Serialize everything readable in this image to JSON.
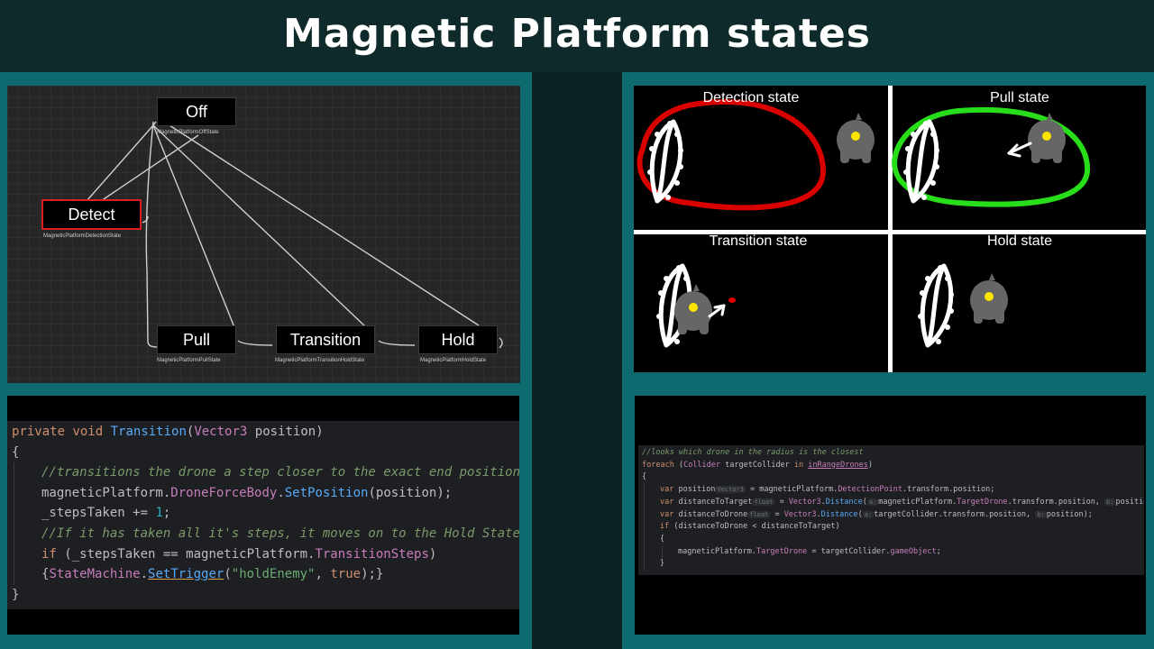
{
  "title": "Magnetic Platform states",
  "colors": {
    "background": "#0d2224",
    "accent": "#0d6a6e",
    "detect_outline": "#d90000",
    "pull_outline": "#28dd19",
    "drone": "#666666"
  },
  "state_graph": {
    "nodes": [
      {
        "id": "off",
        "label": "Off",
        "sub": "MagneticPlatformOffState"
      },
      {
        "id": "detect",
        "label": "Detect",
        "sub": "MagneticPlatformDetectionState",
        "active": true
      },
      {
        "id": "pull",
        "label": "Pull",
        "sub": "MagneticPlatformPullState"
      },
      {
        "id": "transition",
        "label": "Transition",
        "sub": "MagneticPlatformTransitionHoldState"
      },
      {
        "id": "hold",
        "label": "Hold",
        "sub": "MagneticPlatformHoldState"
      }
    ]
  },
  "states_illustration": {
    "panels": [
      {
        "title": "Detection state"
      },
      {
        "title": "Pull state"
      },
      {
        "title": "Transition state"
      },
      {
        "title": "Hold state"
      }
    ]
  },
  "code_left": {
    "lines": [
      {
        "indent": 0,
        "tokens": [
          {
            "t": "private ",
            "c": "kw"
          },
          {
            "t": "void ",
            "c": "kw"
          },
          {
            "t": "Transition",
            "c": "fn"
          },
          {
            "t": "(",
            "c": "txt"
          },
          {
            "t": "Vector3",
            "c": "type"
          },
          {
            "t": " position)",
            "c": "txt"
          }
        ]
      },
      {
        "indent": 0,
        "tokens": [
          {
            "t": "{",
            "c": "txt"
          }
        ]
      },
      {
        "indent": 1,
        "tokens": [
          {
            "t": "//transitions the drone a step closer to the exact end position",
            "c": "cm"
          }
        ]
      },
      {
        "indent": 1,
        "tokens": [
          {
            "t": "magneticPlatform.",
            "c": "txt"
          },
          {
            "t": "DroneForceBody",
            "c": "prop"
          },
          {
            "t": ".",
            "c": "txt"
          },
          {
            "t": "SetPosition",
            "c": "fn"
          },
          {
            "t": "(position);",
            "c": "txt"
          }
        ]
      },
      {
        "indent": 1,
        "tokens": [
          {
            "t": "_stepsTaken += ",
            "c": "txt"
          },
          {
            "t": "1",
            "c": "num"
          },
          {
            "t": ";",
            "c": "txt"
          }
        ]
      },
      {
        "indent": 1,
        "tokens": [
          {
            "t": "//If it has taken all it's steps, it moves on to the Hold State",
            "c": "cm"
          }
        ]
      },
      {
        "indent": 1,
        "tokens": [
          {
            "t": "if ",
            "c": "kw"
          },
          {
            "t": "(_stepsTaken == magneticPlatform.",
            "c": "txt"
          },
          {
            "t": "TransitionSteps",
            "c": "prop"
          },
          {
            "t": ")",
            "c": "txt"
          }
        ]
      },
      {
        "indent": 1,
        "tokens": [
          {
            "t": "{",
            "c": "txt"
          },
          {
            "t": "StateMachine",
            "c": "prop"
          },
          {
            "t": ".",
            "c": "txt"
          },
          {
            "t": "SetTrigger",
            "c": "fn"
          },
          {
            "t": "(",
            "c": "txt"
          },
          {
            "t": "\"holdEnemy\"",
            "c": "str"
          },
          {
            "t": ", ",
            "c": "txt"
          },
          {
            "t": "true",
            "c": "kw"
          },
          {
            "t": ");}",
            "c": "txt"
          }
        ]
      },
      {
        "indent": 0,
        "tokens": [
          {
            "t": "}",
            "c": "txt"
          }
        ]
      }
    ]
  },
  "code_right": {
    "lines": [
      {
        "indent": 0,
        "tokens": [
          {
            "t": "//looks which drone in the radius is the closest",
            "c": "cm"
          }
        ]
      },
      {
        "indent": 0,
        "tokens": [
          {
            "t": "foreach ",
            "c": "kw"
          },
          {
            "t": "(",
            "c": "txt"
          },
          {
            "t": "Collider",
            "c": "type"
          },
          {
            "t": " targetCollider ",
            "c": "txt"
          },
          {
            "t": "in ",
            "c": "kw"
          },
          {
            "t": "inRangeDrones",
            "c": "prop"
          },
          {
            "t": ")",
            "c": "txt"
          }
        ]
      },
      {
        "indent": 0,
        "tokens": [
          {
            "t": "{",
            "c": "txt"
          }
        ]
      },
      {
        "indent": 1,
        "tokens": [
          {
            "t": "var ",
            "c": "kw"
          },
          {
            "t": "position",
            "c": "txt"
          },
          {
            "t": "Vector3",
            "c": "hint"
          },
          {
            "t": " = magneticPlatform.",
            "c": "txt"
          },
          {
            "t": "DetectionPoint",
            "c": "prop"
          },
          {
            "t": ".transform.position;",
            "c": "txt"
          }
        ]
      },
      {
        "indent": 1,
        "tokens": [
          {
            "t": "var ",
            "c": "kw"
          },
          {
            "t": "distanceToTarget",
            "c": "txt"
          },
          {
            "t": "float",
            "c": "hint"
          },
          {
            "t": " = ",
            "c": "txt"
          },
          {
            "t": "Vector3",
            "c": "type"
          },
          {
            "t": ".",
            "c": "txt"
          },
          {
            "t": "Distance",
            "c": "fn"
          },
          {
            "t": "(",
            "c": "txt"
          },
          {
            "t": "a:",
            "c": "hint"
          },
          {
            "t": "magneticPlatform.",
            "c": "txt"
          },
          {
            "t": "TargetDrone",
            "c": "prop"
          },
          {
            "t": ".transform.position, ",
            "c": "txt"
          },
          {
            "t": "b:",
            "c": "hint"
          },
          {
            "t": "position);",
            "c": "txt"
          }
        ]
      },
      {
        "indent": 1,
        "tokens": [
          {
            "t": "var ",
            "c": "kw"
          },
          {
            "t": "distanceToDrone",
            "c": "txt"
          },
          {
            "t": "float",
            "c": "hint"
          },
          {
            "t": " = ",
            "c": "txt"
          },
          {
            "t": "Vector3",
            "c": "type"
          },
          {
            "t": ".",
            "c": "txt"
          },
          {
            "t": "Distance",
            "c": "fn"
          },
          {
            "t": "(",
            "c": "txt"
          },
          {
            "t": "a:",
            "c": "hint"
          },
          {
            "t": "targetCollider.transform.position, ",
            "c": "txt"
          },
          {
            "t": "b:",
            "c": "hint"
          },
          {
            "t": "position);",
            "c": "txt"
          }
        ]
      },
      {
        "indent": 1,
        "tokens": [
          {
            "t": "if ",
            "c": "kw"
          },
          {
            "t": "(distanceToDrone < distanceToTarget)",
            "c": "txt"
          }
        ]
      },
      {
        "indent": 1,
        "tokens": [
          {
            "t": "{",
            "c": "txt"
          }
        ]
      },
      {
        "indent": 2,
        "tokens": [
          {
            "t": "magneticPlatform.",
            "c": "txt"
          },
          {
            "t": "TargetDrone",
            "c": "prop"
          },
          {
            "t": " = targetCollider.",
            "c": "txt"
          },
          {
            "t": "gameObject",
            "c": "prop"
          },
          {
            "t": ";",
            "c": "txt"
          }
        ]
      },
      {
        "indent": 1,
        "tokens": [
          {
            "t": "}",
            "c": "txt"
          }
        ]
      }
    ]
  }
}
